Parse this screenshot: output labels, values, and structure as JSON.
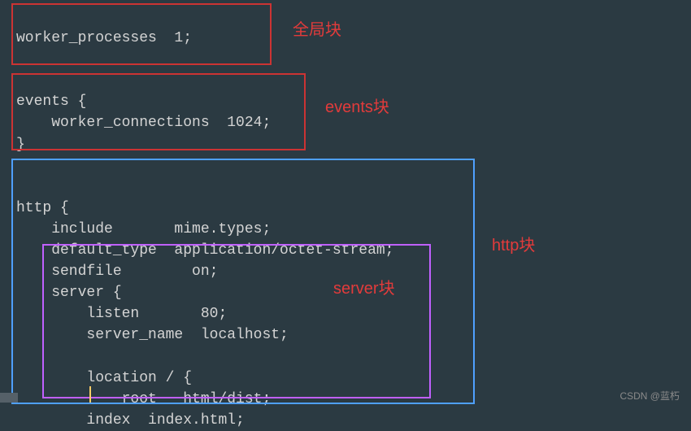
{
  "code": {
    "l1": "worker_processes  1;",
    "l2": "",
    "l3": "",
    "l4": "events {",
    "l5": "    worker_connections  1024;",
    "l6": "}",
    "l7": "",
    "l8": "",
    "l9": "http {",
    "l10": "    include       mime.types;",
    "l11": "    default_type  application/octet-stream;",
    "l12": "    sendfile        on;",
    "l13": "    server {",
    "l14": "        listen       80;",
    "l15": "        server_name  localhost;",
    "l16": "",
    "l17": "        location / {",
    "l18": "            root   html/dist;",
    "l19": "        index  index.html;"
  },
  "labels": {
    "global": "全局块",
    "events": "events块",
    "http": "http块",
    "server": "server块"
  },
  "watermark": "CSDN @蓝朽"
}
